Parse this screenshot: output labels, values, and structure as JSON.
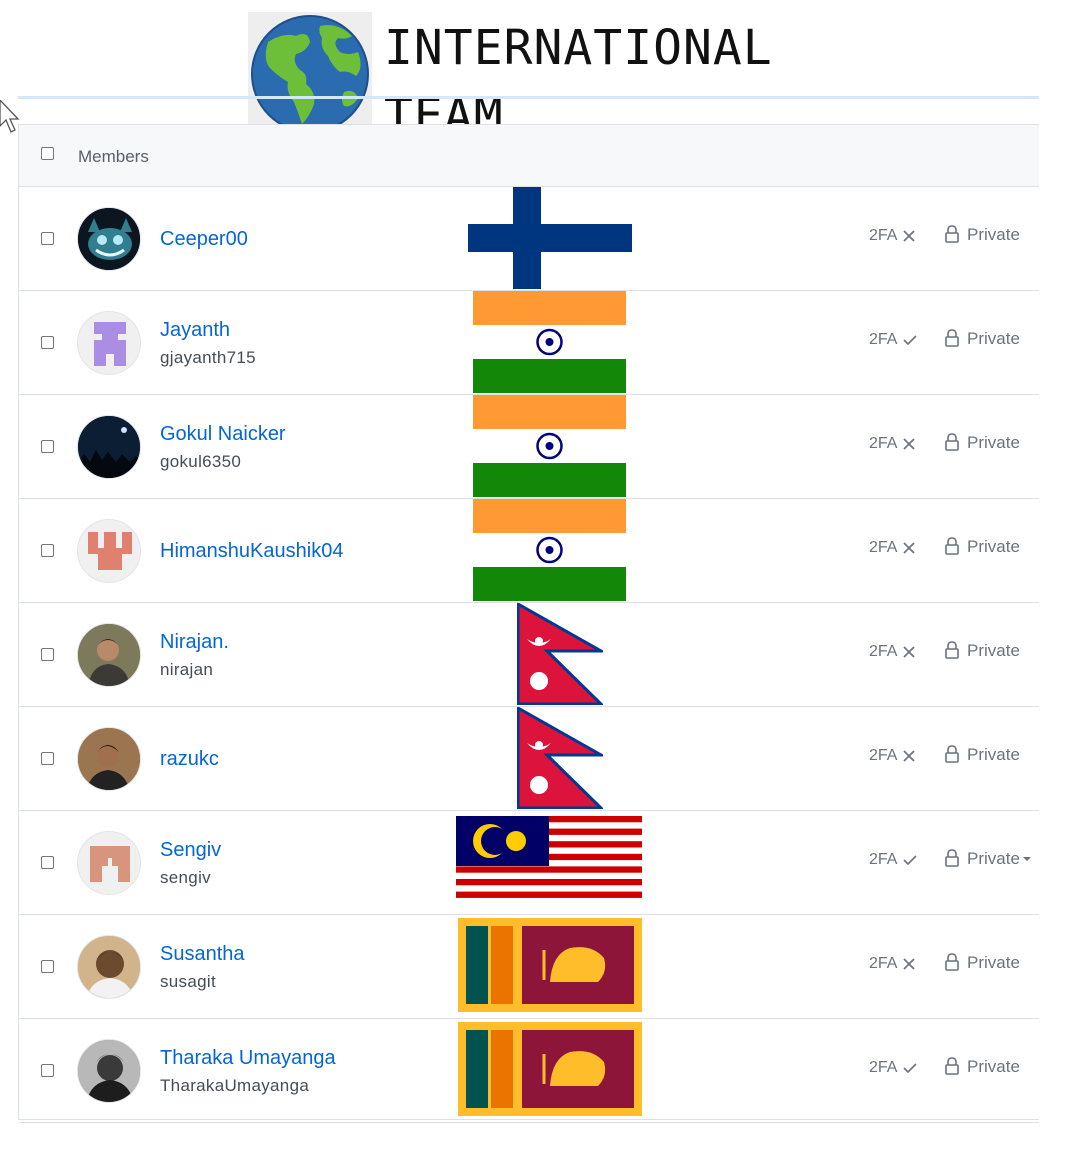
{
  "team": {
    "title": "INTERNATIONAL TEAM"
  },
  "table": {
    "header": "Members"
  },
  "members": [
    {
      "name": "Ceeper00",
      "login": "",
      "flag": "finland",
      "two_fa": "2FA",
      "two_fa_enabled": false,
      "visibility": "Private"
    },
    {
      "name": "Jayanth",
      "login": "gjayanth715",
      "flag": "india",
      "two_fa": "2FA",
      "two_fa_enabled": true,
      "visibility": "Private"
    },
    {
      "name": "Gokul Naicker",
      "login": "gokul6350",
      "flag": "india",
      "two_fa": "2FA",
      "two_fa_enabled": false,
      "visibility": "Private"
    },
    {
      "name": "HimanshuKaushik04",
      "login": "",
      "flag": "india",
      "two_fa": "2FA",
      "two_fa_enabled": false,
      "visibility": "Private"
    },
    {
      "name": "Nirajan.",
      "login": "nirajan",
      "flag": "nepal",
      "two_fa": "2FA",
      "two_fa_enabled": false,
      "visibility": "Private"
    },
    {
      "name": "razukc",
      "login": "",
      "flag": "nepal",
      "two_fa": "2FA",
      "two_fa_enabled": false,
      "visibility": "Private"
    },
    {
      "name": "Sengiv",
      "login": "sengiv",
      "flag": "malaysia",
      "two_fa": "2FA",
      "two_fa_enabled": true,
      "visibility": "Private"
    },
    {
      "name": "Susantha",
      "login": "susagit",
      "flag": "sri-lanka",
      "two_fa": "2FA",
      "two_fa_enabled": false,
      "visibility": "Private"
    },
    {
      "name": "Tharaka Umayanga",
      "login": "TharakaUmayanga",
      "flag": "sri-lanka",
      "two_fa": "2FA",
      "two_fa_enabled": true,
      "visibility": "Private"
    }
  ],
  "colors": {
    "link": "#0366d6",
    "muted": "#6a737d",
    "border": "#dde1e5",
    "header_bg": "#f6f8fa"
  }
}
